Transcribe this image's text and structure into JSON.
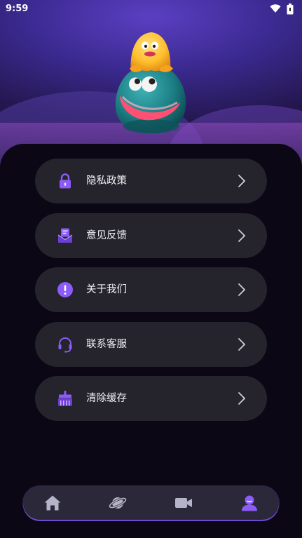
{
  "status_bar": {
    "time": "9:59",
    "wifi_icon": "wifi-icon",
    "battery_icon": "battery-icon"
  },
  "hero": {
    "image": "mascot-illustration"
  },
  "menu": {
    "items": [
      {
        "label": "隐私政策",
        "icon": "lock-icon"
      },
      {
        "label": "意见反馈",
        "icon": "feedback-mail-icon"
      },
      {
        "label": "关于我们",
        "icon": "info-exclamation-icon"
      },
      {
        "label": "联系客服",
        "icon": "headset-icon"
      },
      {
        "label": "清除缓存",
        "icon": "broom-icon"
      }
    ]
  },
  "tabbar": {
    "tabs": [
      {
        "name": "home",
        "icon": "home-icon",
        "active": false
      },
      {
        "name": "discover",
        "icon": "planet-icon",
        "active": false
      },
      {
        "name": "video",
        "icon": "video-camera-icon",
        "active": false
      },
      {
        "name": "profile",
        "icon": "user-icon",
        "active": true
      }
    ]
  },
  "colors": {
    "accent": "#8b5cf6",
    "menu_bg": "#25232c",
    "panel_bg": "#0b0714",
    "tab_inactive": "#9a98b0"
  }
}
